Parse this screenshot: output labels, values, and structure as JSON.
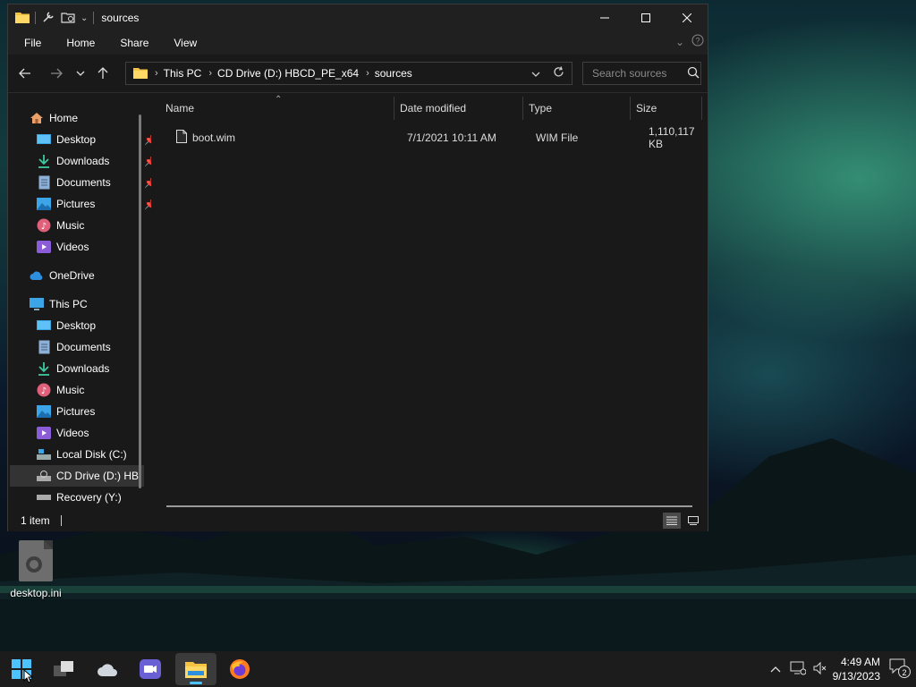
{
  "window": {
    "title": "sources",
    "ribbon_tabs": [
      "File",
      "Home",
      "Share",
      "View"
    ]
  },
  "address": {
    "crumbs": [
      "This PC",
      "CD Drive (D:) HBCD_PE_x64",
      "sources"
    ]
  },
  "search": {
    "placeholder": "Search sources"
  },
  "nav": {
    "quick_access": [
      {
        "label": "Home"
      },
      {
        "label": "Desktop",
        "pinned": true
      },
      {
        "label": "Downloads",
        "pinned": true
      },
      {
        "label": "Documents",
        "pinned": true
      },
      {
        "label": "Pictures",
        "pinned": true
      },
      {
        "label": "Music"
      },
      {
        "label": "Videos"
      }
    ],
    "onedrive": "OneDrive",
    "this_pc": "This PC",
    "this_pc_items": [
      {
        "label": "Desktop"
      },
      {
        "label": "Documents"
      },
      {
        "label": "Downloads"
      },
      {
        "label": "Music"
      },
      {
        "label": "Pictures"
      },
      {
        "label": "Videos"
      },
      {
        "label": "Local Disk (C:)"
      },
      {
        "label": "CD Drive (D:) HB"
      },
      {
        "label": "Recovery (Y:)"
      }
    ]
  },
  "columns": [
    "Name",
    "Date modified",
    "Type",
    "Size"
  ],
  "files": [
    {
      "name": "boot.wim",
      "date": "7/1/2021 10:11 AM",
      "type": "WIM File",
      "size": "1,110,117 KB"
    }
  ],
  "status": {
    "count": "1 item"
  },
  "desktop": {
    "icon_label": "desktop.ini"
  },
  "taskbar": {
    "time": "4:49 AM",
    "date": "9/13/2023",
    "notifications": "2"
  },
  "colors": {
    "accent": "#0078d4",
    "folder": "#f5c342",
    "window_bg": "#191919"
  }
}
